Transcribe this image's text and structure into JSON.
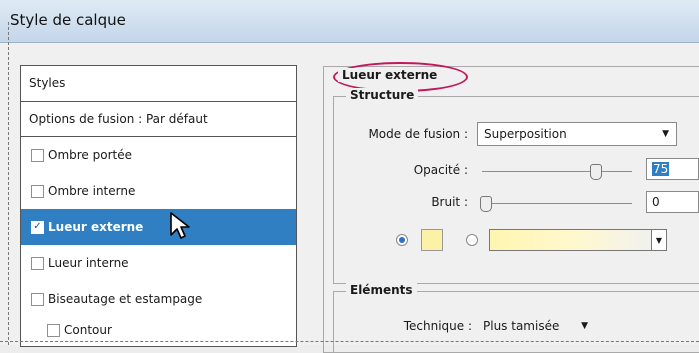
{
  "window": {
    "title": "Style de calque"
  },
  "styles_panel": {
    "header": "Styles",
    "blend_options": "Options de fusion : Par défaut",
    "items": [
      {
        "label": "Ombre portée",
        "checked": false,
        "selected": false
      },
      {
        "label": "Ombre interne",
        "checked": false,
        "selected": false
      },
      {
        "label": "Lueur externe",
        "checked": true,
        "selected": true
      },
      {
        "label": "Lueur interne",
        "checked": false,
        "selected": false
      },
      {
        "label": "Biseautage et estampage",
        "checked": false,
        "selected": false
      },
      {
        "label": "Contour",
        "checked": false,
        "selected": false
      }
    ]
  },
  "outer_glow": {
    "title": "Lueur externe",
    "structure": {
      "title": "Structure",
      "blend_mode_label": "Mode de fusion :",
      "blend_mode_value": "Superposition",
      "opacity_label": "Opacité :",
      "opacity_value": "75",
      "opacity_level": 0.75,
      "noise_label": "Bruit :",
      "noise_value": "0",
      "noise_level": 0,
      "color_swatch": "#fbf2a8"
    },
    "elements": {
      "title": "Eléments",
      "technique_label": "Technique :",
      "technique_value": "Plus tamisée"
    }
  },
  "colors": {
    "accent": "#2f7fc2",
    "highlight_ring": "#c2185b"
  }
}
